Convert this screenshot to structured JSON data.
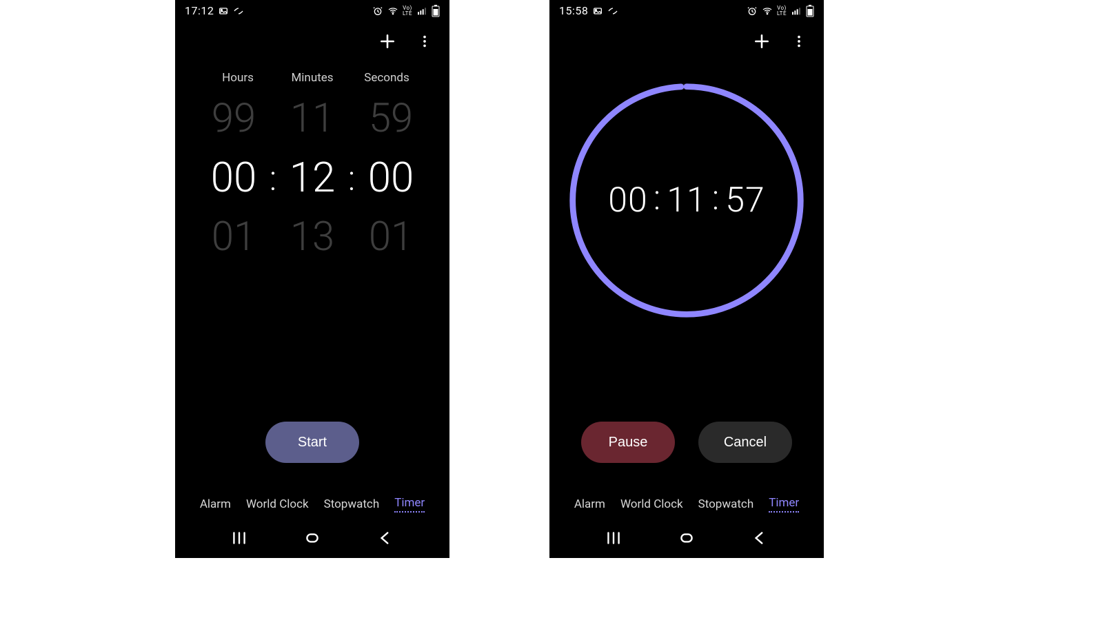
{
  "accent": "#8f86ff",
  "left": {
    "status_time": "17:12",
    "labels": {
      "hours": "Hours",
      "minutes": "Minutes",
      "seconds": "Seconds"
    },
    "picker": {
      "hours": {
        "prev": "99",
        "sel": "00",
        "next": "01"
      },
      "minutes": {
        "prev": "11",
        "sel": "12",
        "next": "13"
      },
      "seconds": {
        "prev": "59",
        "sel": "00",
        "next": "01"
      }
    },
    "start_label": "Start"
  },
  "right": {
    "status_time": "15:58",
    "countdown": {
      "h": "00",
      "m": "11",
      "s": "57"
    },
    "progress_deg": 357,
    "pause_label": "Pause",
    "cancel_label": "Cancel"
  },
  "tabs": [
    "Alarm",
    "World Clock",
    "Stopwatch",
    "Timer"
  ],
  "active_tab_index": 3,
  "sep": ":"
}
